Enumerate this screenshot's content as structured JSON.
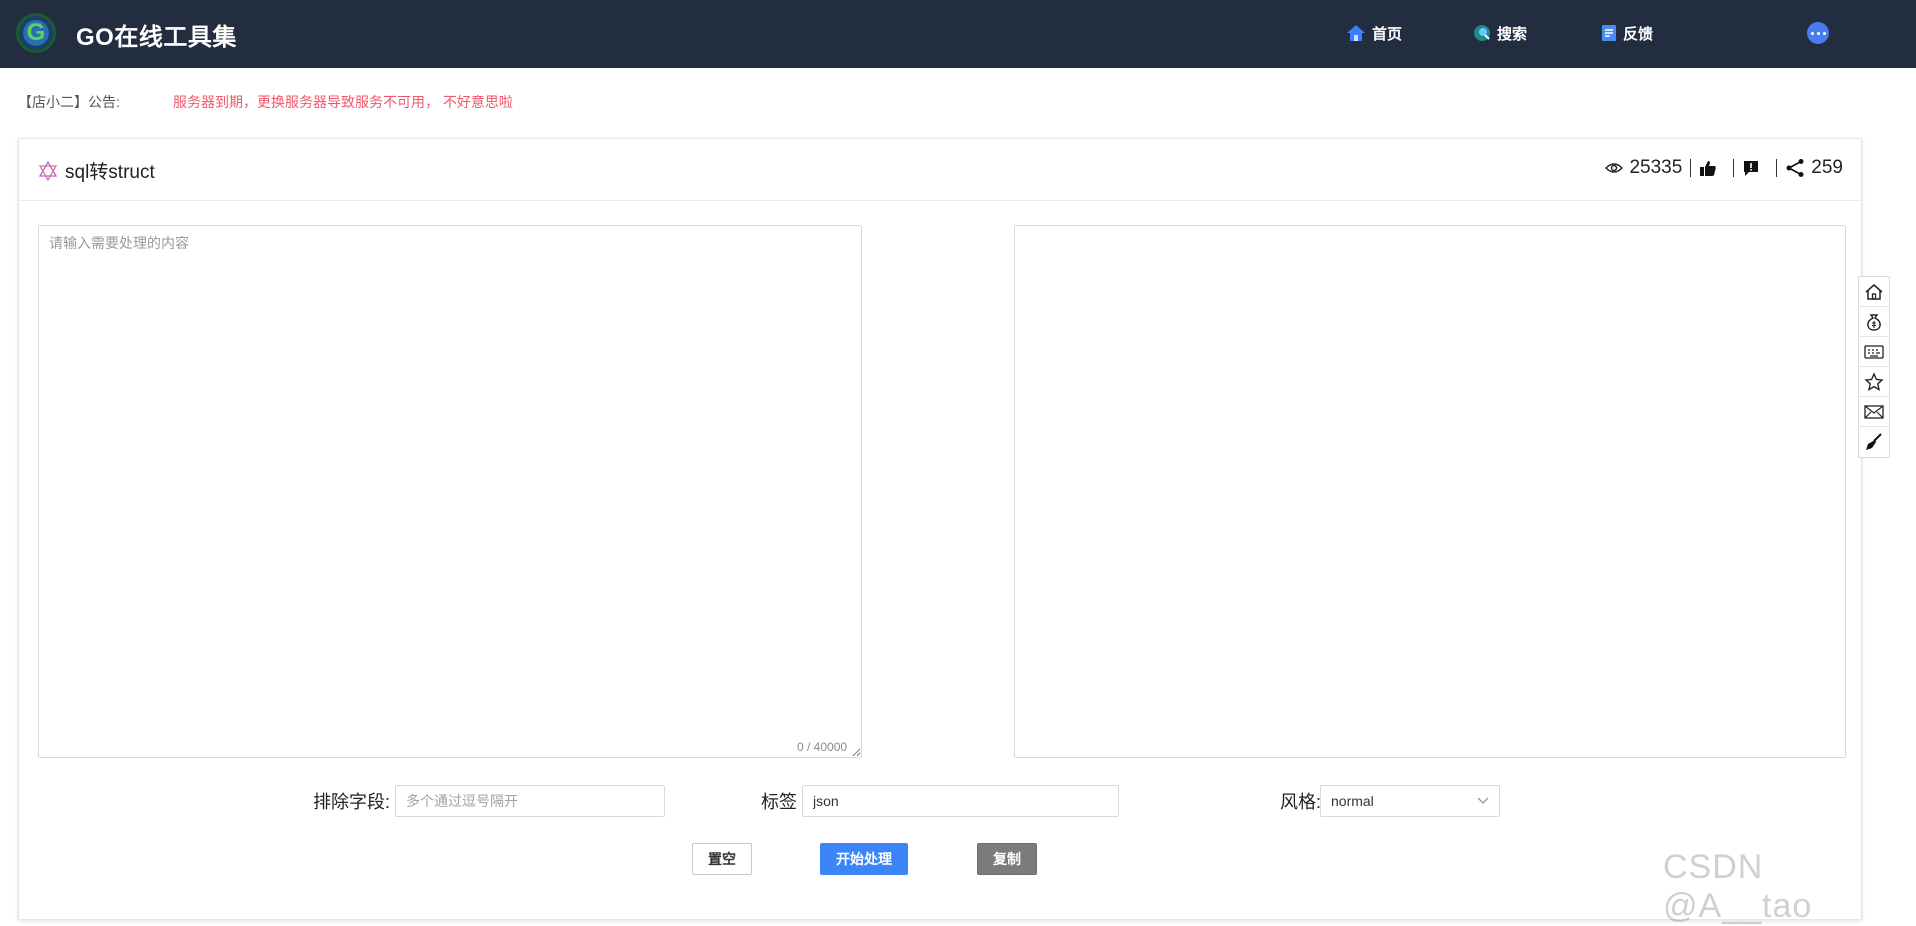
{
  "header": {
    "brand": "GO在线工具集",
    "nav": [
      {
        "label": "首页",
        "icon": "home-icon"
      },
      {
        "label": "搜索",
        "icon": "search-icon"
      },
      {
        "label": "反馈",
        "icon": "feedback-icon"
      }
    ],
    "more_icon": "more-icon"
  },
  "notice": {
    "label": "【店小二】公告:",
    "text": "服务器到期，更换服务器导致服务不可用， 不好意思啦"
  },
  "tool": {
    "title": "sql转struct",
    "views": "25335",
    "shares": "259"
  },
  "editor": {
    "input_placeholder": "请输入需要处理的内容",
    "input_value": "",
    "char_count": "0 / 40000",
    "output_value": ""
  },
  "options": {
    "exclude_label": "排除字段:",
    "exclude_placeholder": "多个通过逗号隔开",
    "tag_label": "标签",
    "tag_value": "json",
    "style_label": "风格:",
    "style_value": "normal"
  },
  "buttons": {
    "clear": "置空",
    "start": "开始处理",
    "copy": "复制"
  },
  "watermark": "CSDN @A__tao",
  "colors": {
    "topbar": "#222d3f",
    "notice": "#f0576b",
    "primary": "#3a86f8",
    "copy_button": "#7b7b7b"
  }
}
